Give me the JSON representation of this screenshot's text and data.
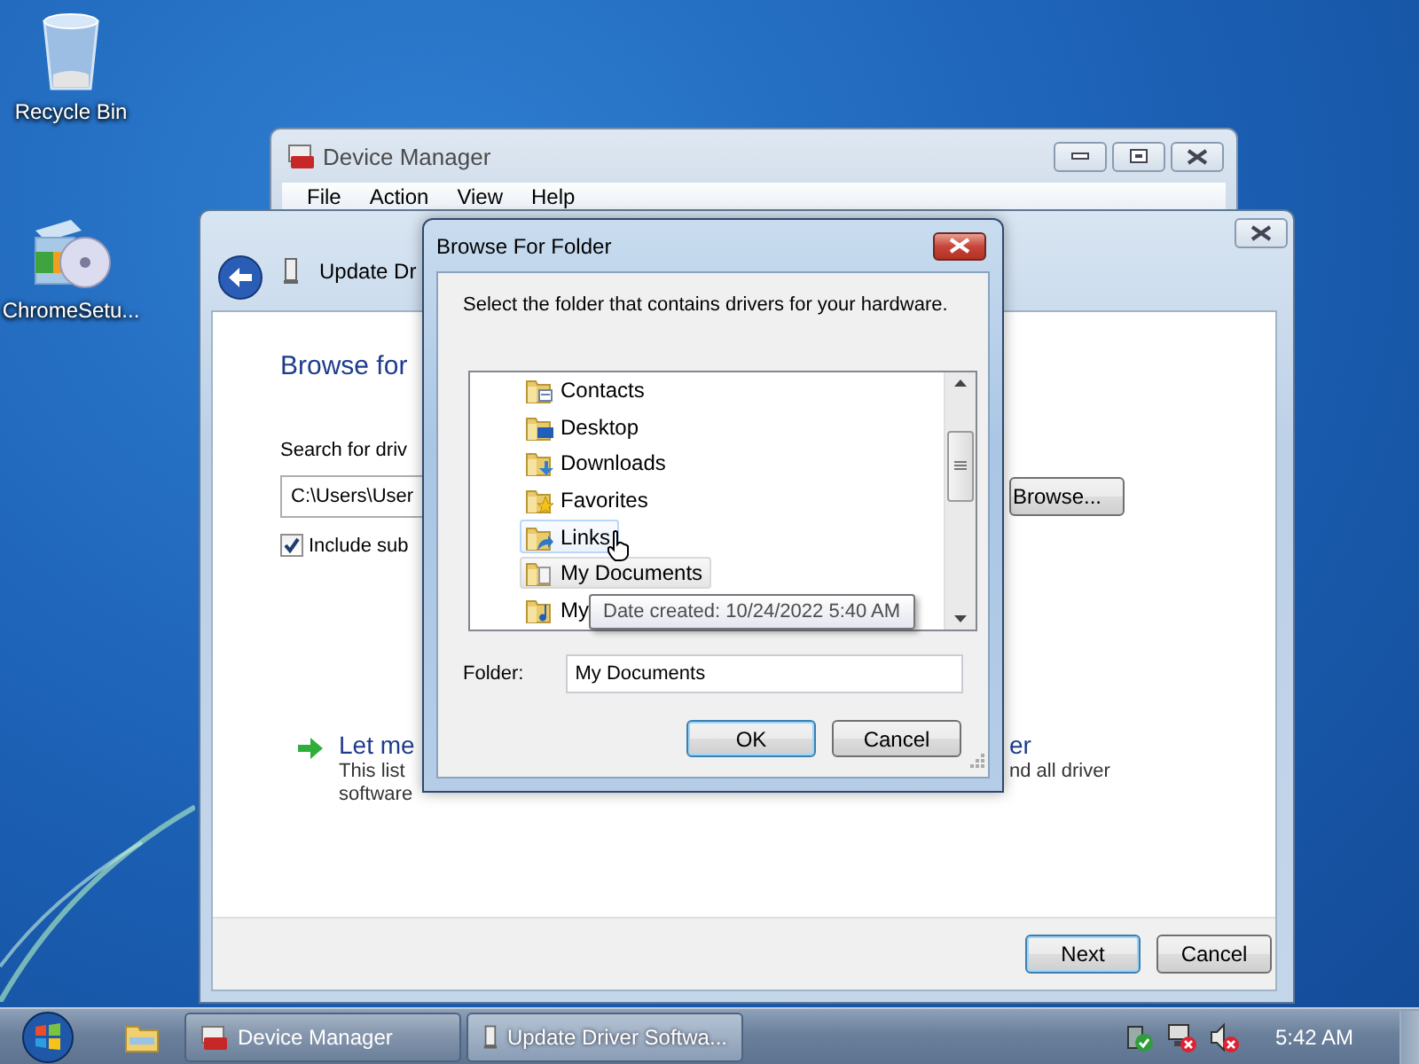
{
  "desktop_icons": [
    {
      "label": "Recycle Bin",
      "kind": "recycle-bin"
    },
    {
      "label": "ChromeSetu...",
      "kind": "installer"
    }
  ],
  "device_manager": {
    "title": "Device Manager",
    "menu": [
      "File",
      "Action",
      "View",
      "Help"
    ]
  },
  "update_driver": {
    "title": "Update Dr",
    "heading": "Browse for",
    "search_label": "Search for driv",
    "path_value": "C:\\Users\\User",
    "browse_button": "Browse...",
    "include_checkbox": {
      "label": "Include sub",
      "checked": true
    },
    "option_title_start": "Let me",
    "option_title_end": "er",
    "option_line1_start": "This list",
    "option_line1_end": "nd all driver",
    "option_line2": "software",
    "buttons": [
      {
        "label": "Next",
        "default": true
      },
      {
        "label": "Cancel",
        "default": false
      }
    ]
  },
  "browse_dialog": {
    "title": "Browse For Folder",
    "instruction": "Select the folder that contains drivers for your hardware.",
    "tree": [
      {
        "label": "Contacts",
        "kind": "contacts",
        "hovered": false,
        "selected": false
      },
      {
        "label": "Desktop",
        "kind": "desktop",
        "hovered": false,
        "selected": false
      },
      {
        "label": "Downloads",
        "kind": "downloads",
        "hovered": false,
        "selected": false
      },
      {
        "label": "Favorites",
        "kind": "favorites",
        "hovered": false,
        "selected": false
      },
      {
        "label": "Links",
        "kind": "links",
        "hovered": true,
        "selected": false
      },
      {
        "label": "My Documents",
        "kind": "documents",
        "hovered": false,
        "selected": true
      },
      {
        "label": "My",
        "kind": "music",
        "hovered": false,
        "selected": false
      }
    ],
    "tooltip": "Date created: 10/24/2022 5:40 AM",
    "folder_label": "Folder:",
    "folder_value": "My Documents",
    "buttons": [
      {
        "label": "OK",
        "default": true
      },
      {
        "label": "Cancel",
        "default": false
      }
    ]
  },
  "taskbar": {
    "tasks": [
      {
        "label": "Device Manager",
        "kind": "device-manager",
        "selected": false
      },
      {
        "label": "Update Driver Softwa...",
        "kind": "driver",
        "selected": true
      }
    ],
    "clock": "5:42 AM"
  }
}
